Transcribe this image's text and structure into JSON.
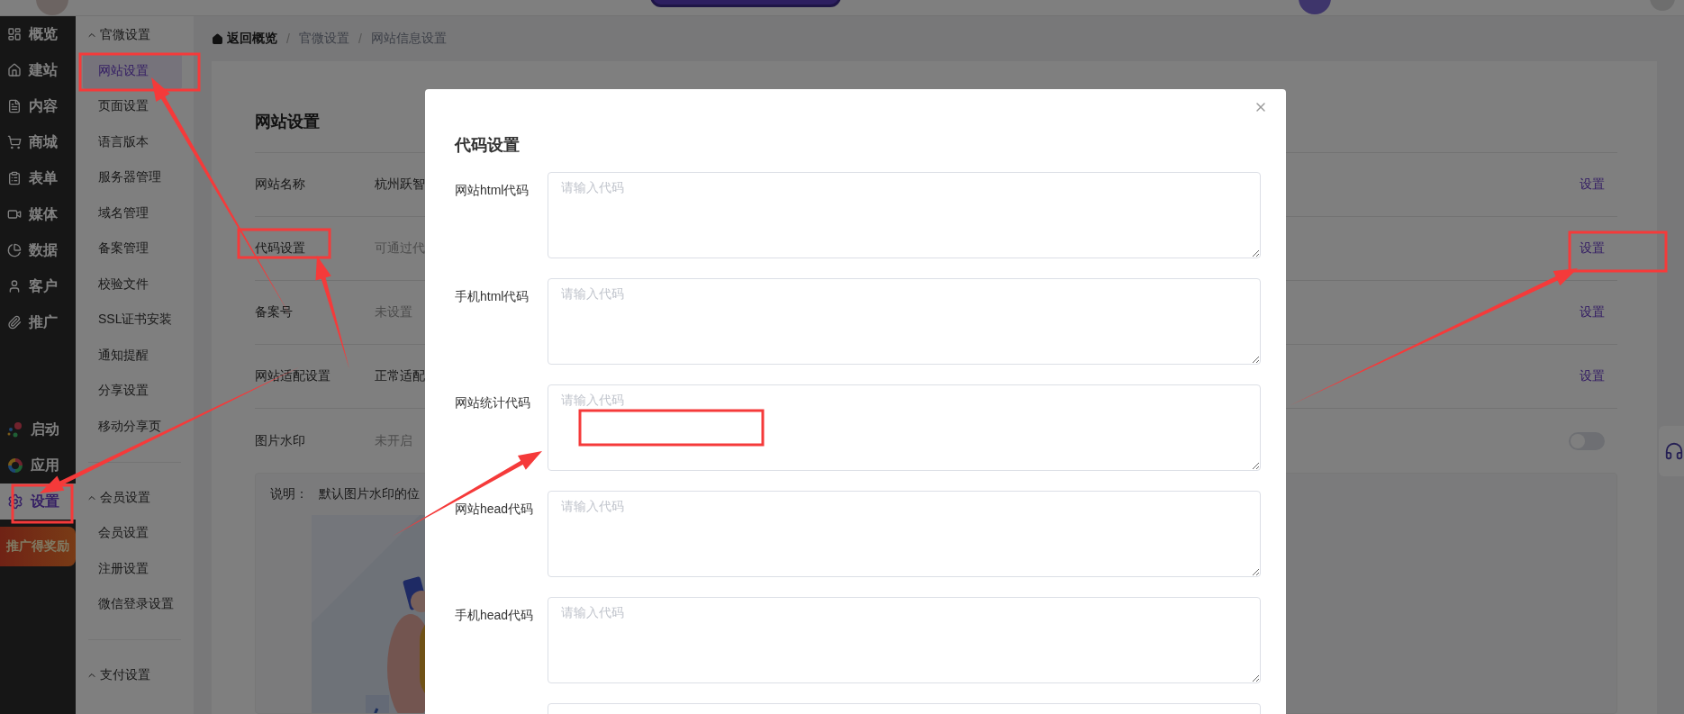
{
  "nav": {
    "items": [
      {
        "label": "概览",
        "selected": false
      },
      {
        "label": "建站",
        "selected": false
      },
      {
        "label": "内容",
        "selected": false
      },
      {
        "label": "商城",
        "selected": false
      },
      {
        "label": "表单",
        "selected": false
      },
      {
        "label": "媒体",
        "selected": false
      },
      {
        "label": "数据",
        "selected": false
      },
      {
        "label": "客户",
        "selected": false
      },
      {
        "label": "推广",
        "selected": false
      }
    ],
    "bottom_items": [
      {
        "label": "启动",
        "selected": false
      },
      {
        "label": "应用",
        "selected": false
      },
      {
        "label": "设置",
        "selected": true
      }
    ],
    "promo": "推广得奖励"
  },
  "subnav": {
    "sections": [
      {
        "title": "官微设置",
        "expanded": true,
        "items": [
          {
            "label": "网站设置",
            "selected": true
          },
          {
            "label": "页面设置",
            "selected": false
          },
          {
            "label": "语言版本",
            "selected": false
          },
          {
            "label": "服务器管理",
            "selected": false
          },
          {
            "label": "域名管理",
            "selected": false
          },
          {
            "label": "备案管理",
            "selected": false
          },
          {
            "label": "校验文件",
            "selected": false
          },
          {
            "label": "SSL证书安装",
            "selected": false
          },
          {
            "label": "通知提醒",
            "selected": false
          },
          {
            "label": "分享设置",
            "selected": false
          },
          {
            "label": "移动分享页",
            "selected": false
          }
        ]
      },
      {
        "title": "会员设置",
        "expanded": true,
        "items": [
          {
            "label": "会员设置",
            "selected": false
          },
          {
            "label": "注册设置",
            "selected": false
          },
          {
            "label": "微信登录设置",
            "selected": false
          }
        ]
      },
      {
        "title": "支付设置",
        "expanded": true
      }
    ]
  },
  "breadcrumb": [
    {
      "label": "返回概览",
      "kind": "home"
    },
    {
      "separator": "/",
      "label": "官微设置",
      "kind": "link"
    },
    {
      "separator": "/",
      "label": "网站信息设置",
      "kind": "current"
    }
  ],
  "page": {
    "title": "网站设置",
    "rows": [
      {
        "kind": "link",
        "label": "网站名称",
        "value": "杭州跃智",
        "muted": false,
        "action": "设置"
      },
      {
        "kind": "link",
        "label": "代码设置",
        "value": "可通过代",
        "muted": true,
        "action": "设置"
      },
      {
        "kind": "link",
        "label": "备案号",
        "value": "未设置",
        "muted": true,
        "action": "设置"
      },
      {
        "kind": "link",
        "label": "网站适配设置",
        "value": "正常适配",
        "muted": false,
        "action": "设置"
      },
      {
        "kind": "toggle",
        "label": "图片水印",
        "value": "未开启",
        "muted": true,
        "on": false
      }
    ],
    "note": {
      "label": "说明：",
      "text": "默认图片水印的位"
    }
  },
  "modal": {
    "title": "代码设置",
    "fields": [
      {
        "label": "网站html代码",
        "placeholder": "请输入代码"
      },
      {
        "label": "手机html代码",
        "placeholder": "请输入代码"
      },
      {
        "label": "网站统计代码",
        "placeholder": "请输入代码"
      },
      {
        "label": "网站head代码",
        "placeholder": "请输入代码"
      },
      {
        "label": "手机head代码",
        "placeholder": "请输入代码"
      }
    ],
    "more_below": true
  }
}
